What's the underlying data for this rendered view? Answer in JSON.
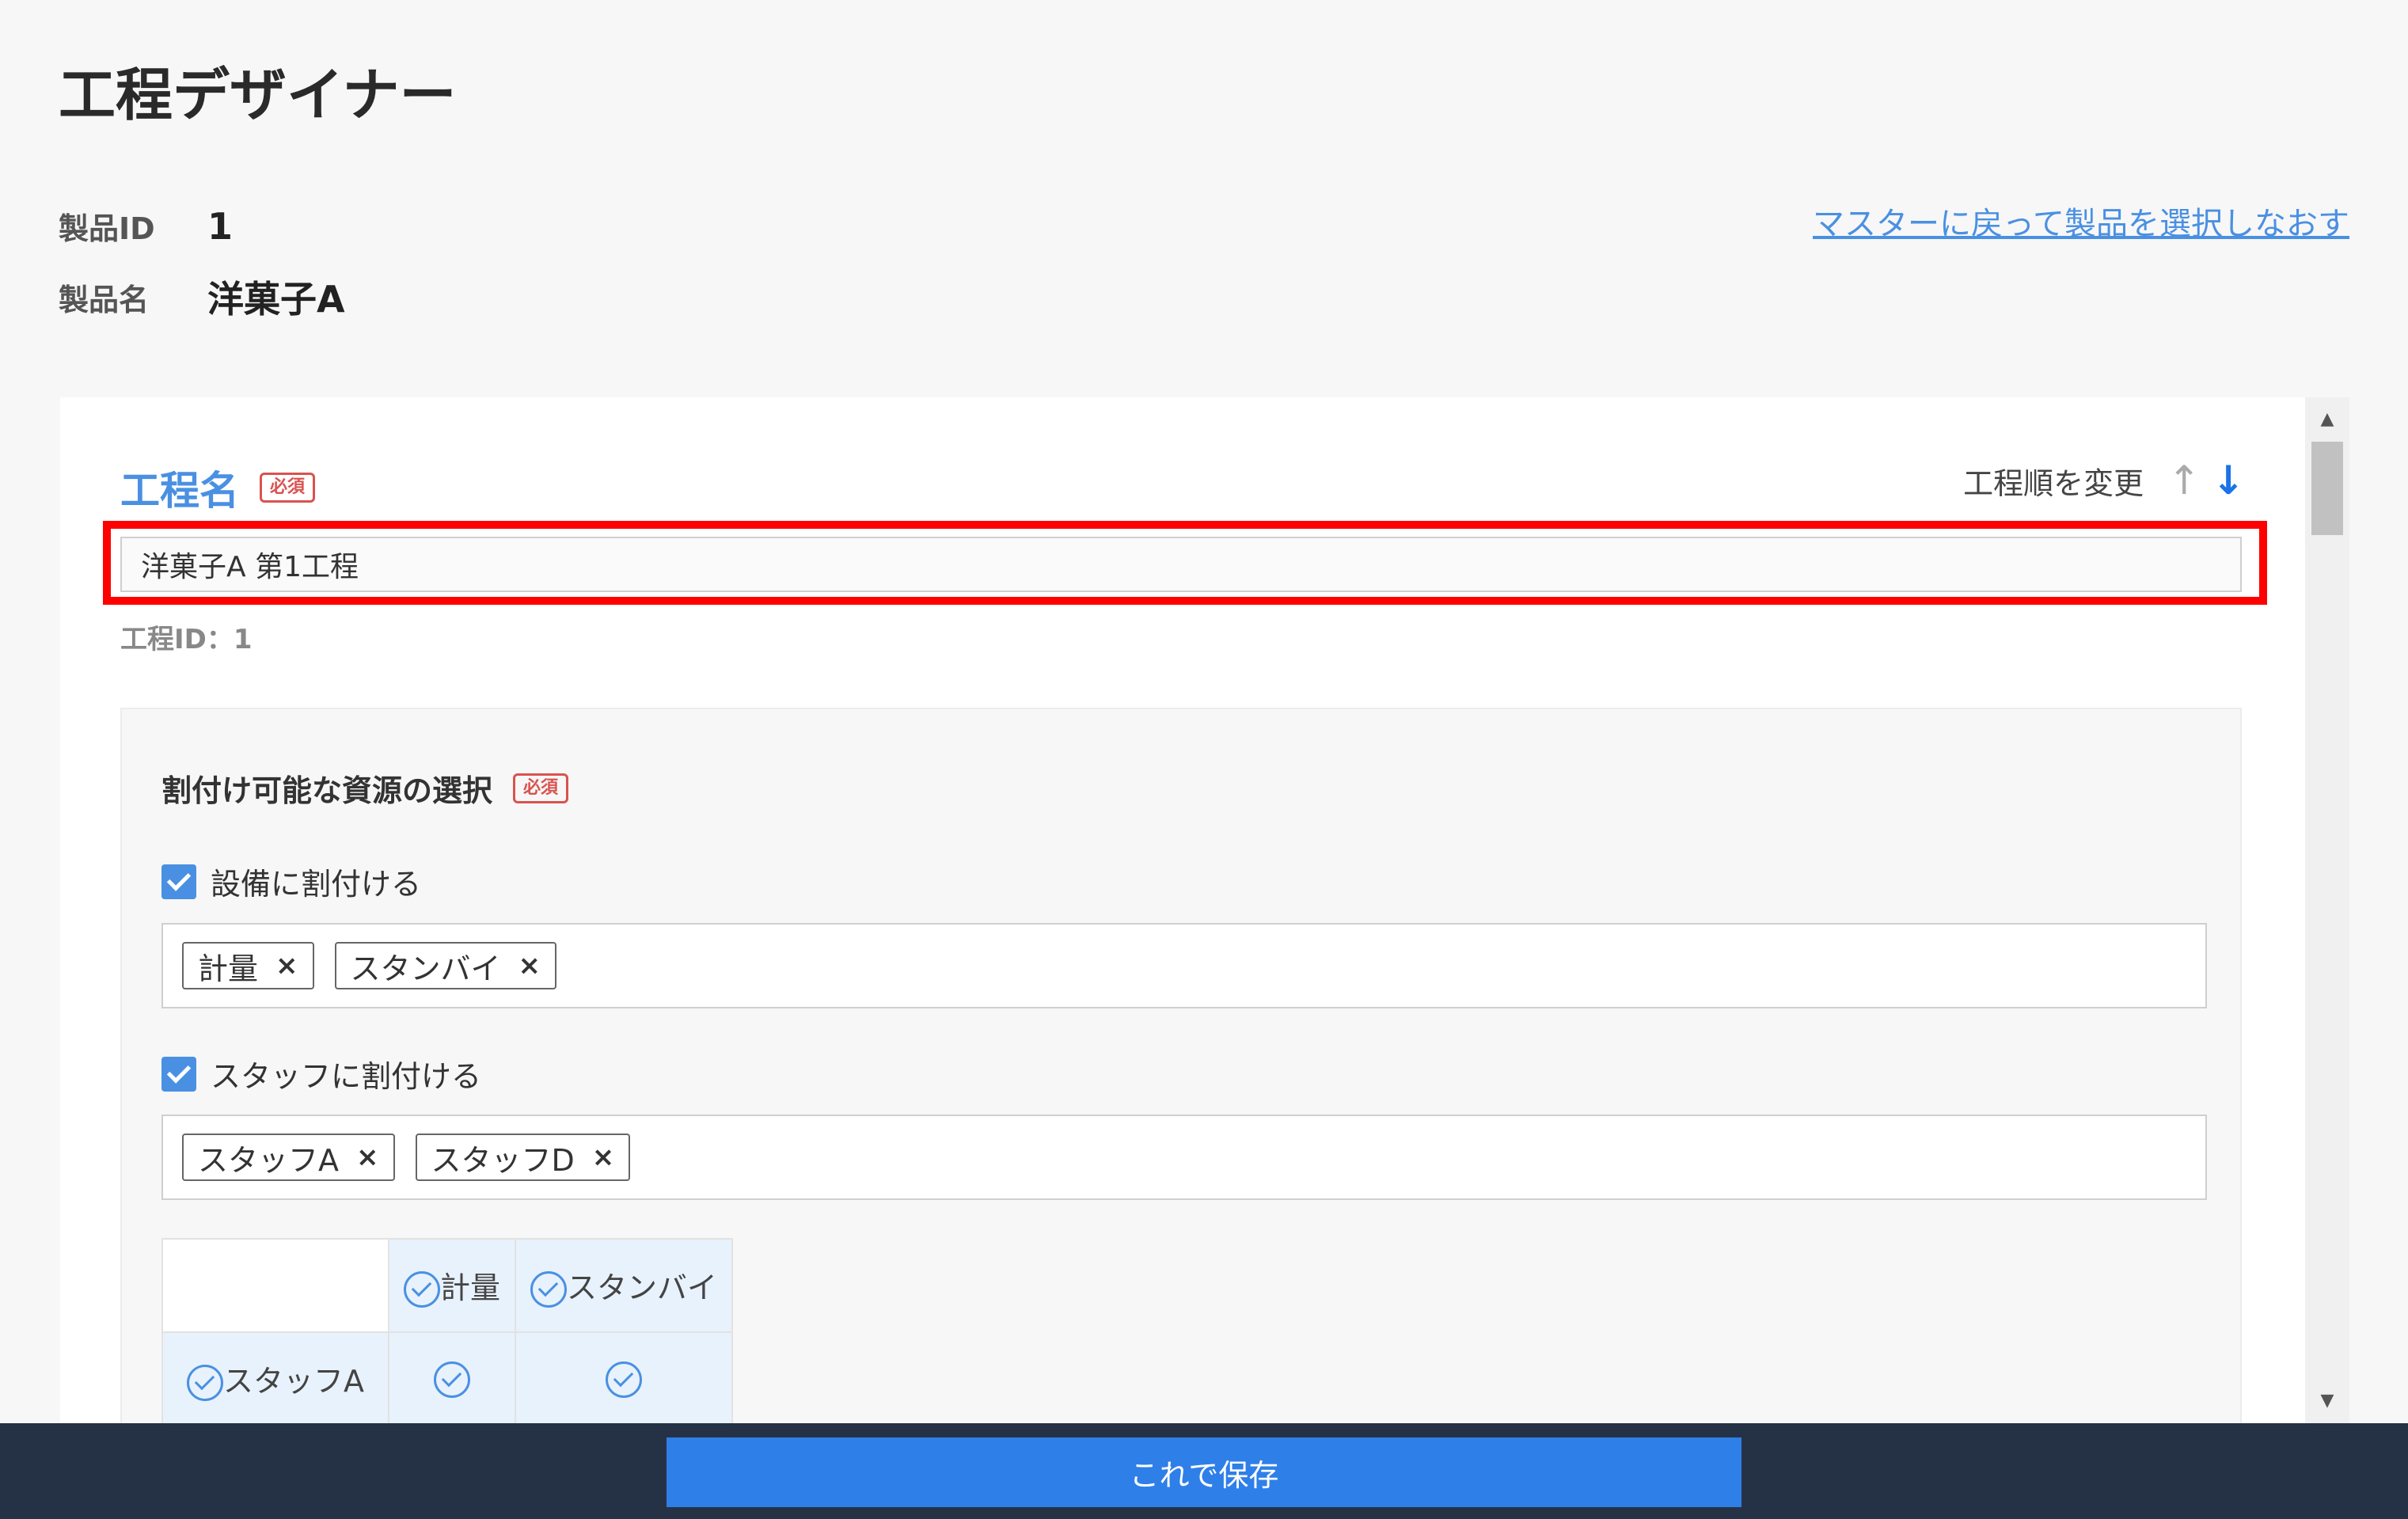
{
  "page": {
    "title": "工程デザイナー"
  },
  "product": {
    "id_label": "製品ID",
    "id_value": "1",
    "name_label": "製品名",
    "name_value": "洋菓子A",
    "back_link": "マスターに戻って製品を選択しなおす"
  },
  "process": {
    "name_label": "工程名",
    "required_badge": "必須",
    "reorder_label": "工程順を変更",
    "name_value": "洋菓子A 第1工程",
    "id_text": "工程ID：1"
  },
  "resources": {
    "title": "割付け可能な資源の選択",
    "required_badge": "必須",
    "equipment": {
      "label": "設備に割付ける",
      "checked": true,
      "tags": [
        "計量",
        "スタンバイ"
      ]
    },
    "staff": {
      "label": "スタッフに割付ける",
      "checked": true,
      "tags": [
        "スタッフA",
        "スタッフD"
      ]
    },
    "matrix": {
      "columns": [
        "計量",
        "スタンバイ"
      ],
      "rows": [
        {
          "label": "スタッフA",
          "cells": [
            true,
            true
          ]
        }
      ]
    }
  },
  "footer": {
    "save_label": "これで保存"
  },
  "colors": {
    "accent": "#4a90e2",
    "highlight": "#ff0000",
    "footer_bg": "#253245",
    "save_button": "#2f7fe8"
  }
}
